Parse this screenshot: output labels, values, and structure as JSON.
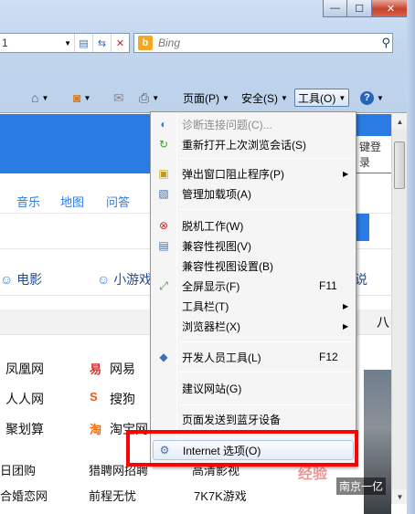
{
  "window": {
    "minimize_glyph": "—",
    "maximize_glyph": "☐",
    "close_glyph": "✕"
  },
  "address_bar": {
    "text": "1",
    "compat_icon": "compat-view-icon",
    "refresh_icon": "refresh-icon",
    "stop_icon": "stop-icon"
  },
  "search": {
    "provider_icon": "bing-logo-icon",
    "placeholder": "Bing",
    "go_icon": "search-icon"
  },
  "command_bar": {
    "page_label": "页面(P)",
    "safety_label": "安全(S)",
    "tools_label": "工具(O)",
    "help_icon": "help-icon"
  },
  "page": {
    "login_text": "键登录",
    "nav_links": [
      "音乐",
      "地图",
      "问答"
    ],
    "tabs": [
      "电影",
      "小游戏",
      "说"
    ],
    "tab_right": "八",
    "sites": {
      "row1": [
        "凤凰网",
        "网易"
      ],
      "row2": [
        "人人网",
        "搜狗"
      ],
      "row3": [
        "聚划算",
        "淘宝网"
      ],
      "row4": [
        "日团购",
        "猎聘网招聘",
        "高清影视"
      ],
      "row5": [
        "合婚恋网",
        "前程无忧",
        "7K7K游戏"
      ]
    },
    "photo_caption": "南京一亿"
  },
  "tools_menu": {
    "items": [
      {
        "label": "诊断连接问题(C)...",
        "disabled": true,
        "icon": "diagnose-icon"
      },
      {
        "label": "重新打开上次浏览会话(S)",
        "icon": "reopen-session-icon"
      },
      {
        "label": "弹出窗口阻止程序(P)",
        "submenu": true,
        "icon": "popup-blocker-icon"
      },
      {
        "label": "管理加载项(A)",
        "icon": "addons-icon"
      },
      {
        "label": "脱机工作(W)",
        "icon": "offline-icon"
      },
      {
        "label": "兼容性视图(V)",
        "icon": "compat-view-icon"
      },
      {
        "label": "兼容性视图设置(B)",
        "icon": ""
      },
      {
        "label": "全屏显示(F)",
        "shortcut": "F11",
        "icon": "fullscreen-icon"
      },
      {
        "label": "工具栏(T)",
        "submenu": true,
        "icon": ""
      },
      {
        "label": "浏览器栏(X)",
        "submenu": true,
        "icon": ""
      },
      {
        "label": "开发人员工具(L)",
        "shortcut": "F12",
        "icon": "dev-tools-icon"
      },
      {
        "label": "建议网站(G)",
        "icon": ""
      },
      {
        "label": "页面发送到蓝牙设备",
        "icon": ""
      },
      {
        "label": "Internet 选项(O)",
        "icon": "internet-options-icon",
        "highlighted": true
      }
    ]
  },
  "annotation": {
    "highlight_color": "#ff0000",
    "watermark": "经验"
  }
}
